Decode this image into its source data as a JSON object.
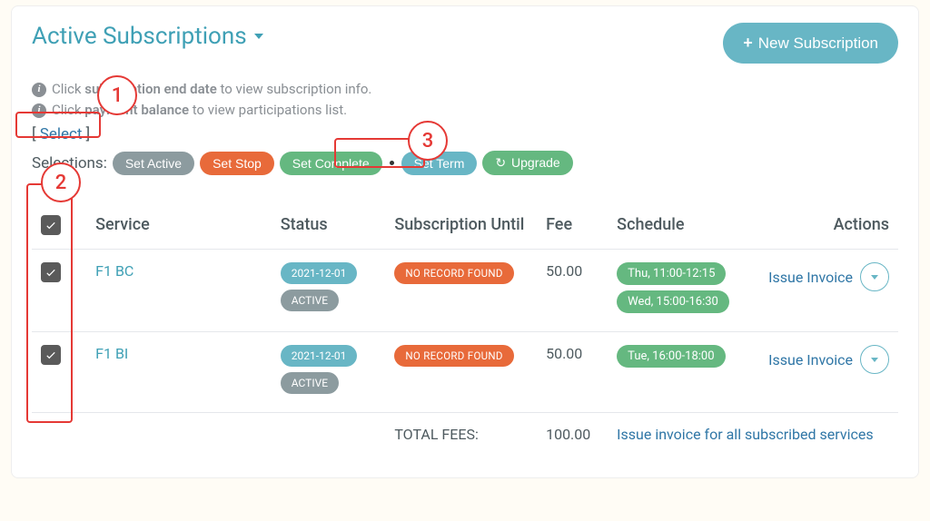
{
  "header": {
    "title": "Active Subscriptions",
    "new_button_label": "New Subscription"
  },
  "info": {
    "line1_pre": "Click ",
    "line1_bold": "subscription end date",
    "line1_post": " to view subscription info.",
    "line2_pre": "Click ",
    "line2_bold": "payment balance",
    "line2_post": " to view participations list."
  },
  "select_toggle": {
    "open": "[ ",
    "label": "Select",
    "close": " ]"
  },
  "selections": {
    "label": "Selections:",
    "set_active": "Set Active",
    "set_stop": "Set Stop",
    "set_complete": "Set Complete",
    "set_term": "Set Term",
    "upgrade": "Upgrade"
  },
  "table": {
    "headers": {
      "service": "Service",
      "status": "Status",
      "subscription_until": "Subscription Until",
      "fee": "Fee",
      "schedule": "Schedule",
      "actions": "Actions"
    },
    "rows": [
      {
        "service": "F1 BC",
        "status_date": "2021-12-01",
        "status_state": "ACTIVE",
        "until": "NO RECORD FOUND",
        "fee": "50.00",
        "schedule": [
          "Thu, 11:00-12:15",
          "Wed, 15:00-16:30"
        ],
        "action_label": "Issue Invoice"
      },
      {
        "service": "F1 BI",
        "status_date": "2021-12-01",
        "status_state": "ACTIVE",
        "until": "NO RECORD FOUND",
        "fee": "50.00",
        "schedule": [
          "Tue, 16:00-18:00"
        ],
        "action_label": "Issue Invoice"
      }
    ],
    "footer": {
      "total_fees_label": "TOTAL FEES:",
      "total_fees_value": "100.00",
      "issue_all_label": "Issue invoice for all subscribed services"
    }
  },
  "annotations": {
    "n1": "1",
    "n2": "2",
    "n3": "3"
  }
}
